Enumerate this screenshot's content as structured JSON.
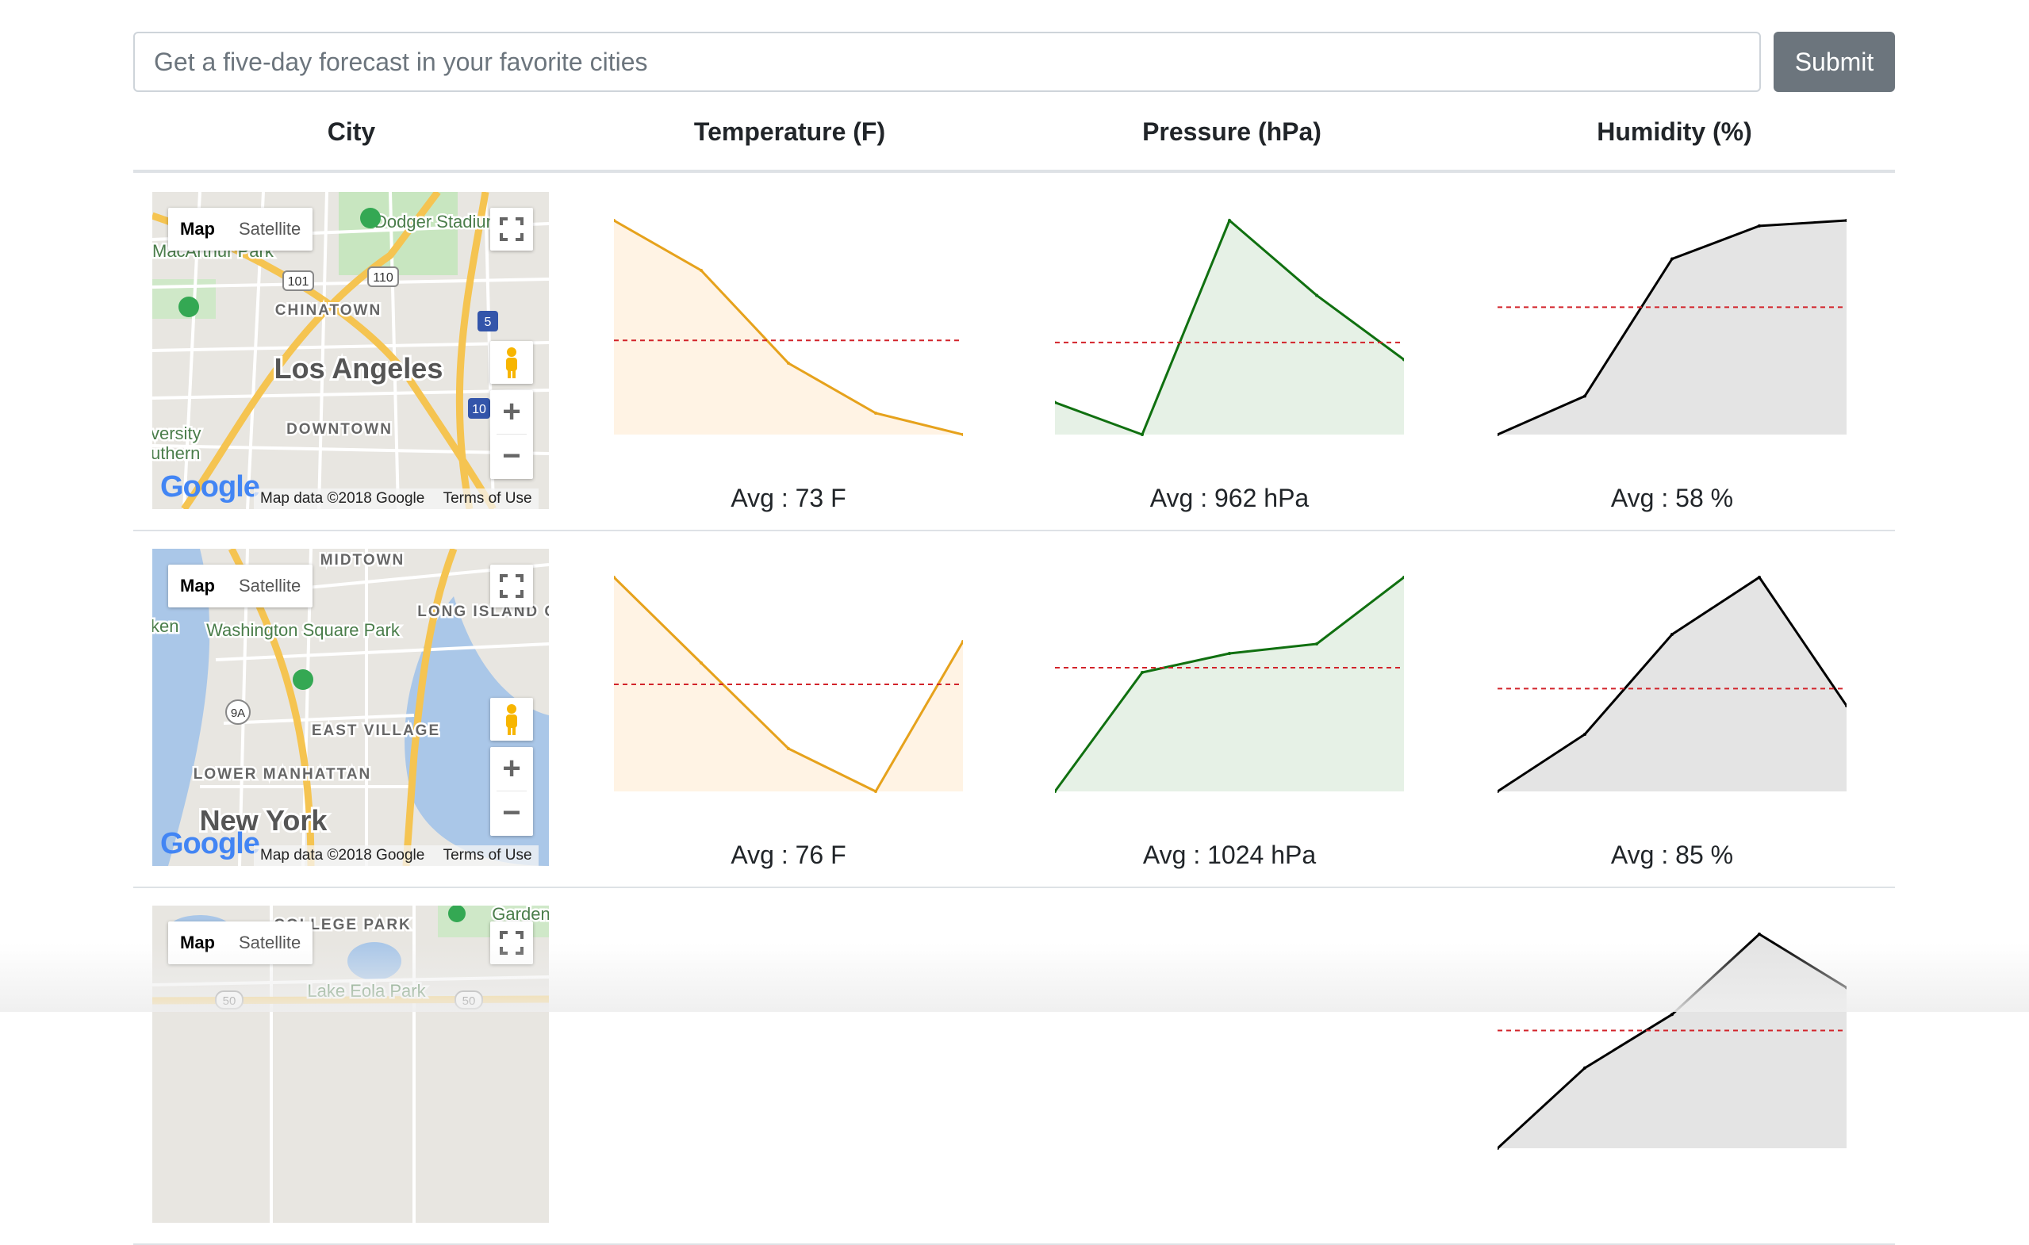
{
  "search": {
    "placeholder": "Get a five-day forecast in your favorite cities",
    "value": "",
    "submit_label": "Submit"
  },
  "table": {
    "headers": [
      "City",
      "Temperature (F)",
      "Pressure (hPa)",
      "Humidity (%)"
    ]
  },
  "map_controls": {
    "map_label": "Map",
    "satellite_label": "Satellite",
    "zoom_in": "+",
    "zoom_out": "−",
    "map_data": "Map data ©2018 Google",
    "terms": "Terms of Use",
    "logo": "Google"
  },
  "colors": {
    "temperature": "#e6a21c",
    "temperature_fill": "#fff3e4",
    "pressure": "#107010",
    "pressure_fill": "#e6f1e6",
    "humidity": "#000000",
    "humidity_fill": "#e4e4e4",
    "average": "#d2232a"
  },
  "rows": [
    {
      "map_labels": {
        "city": "Los Angeles",
        "poi_1": "Dodger Stadium",
        "poi_2": "MacArthur Park",
        "district_1": "CHINATOWN",
        "district_2": "DOWNTOWN",
        "partial": "versity",
        "partial_2": "uthern",
        "route_1": "101",
        "route_2": "110",
        "route_3": "5",
        "route_4": "10"
      },
      "temperature": {
        "values": [
          78,
          74.5,
          68,
          64.5,
          63
        ],
        "avg_label": "Avg : 73 F"
      },
      "pressure": {
        "values": [
          958,
          955,
          975,
          968,
          962
        ],
        "avg_label": "Avg : 962 hPa"
      },
      "humidity": {
        "values": [
          43,
          50,
          75,
          81,
          82
        ],
        "avg_label": "Avg : 58 %"
      }
    },
    {
      "map_labels": {
        "city": "New York",
        "poi_1": "Washington Square Park",
        "district_1": "MIDTOWN",
        "district_2": "EAST VILLAGE",
        "district_3": "LOWER MANHATTAN",
        "district_4": "LONG ISLAND CITY",
        "partial": "ken",
        "route_1": "9A"
      },
      "temperature": {
        "values": [
          78.5,
          76.5,
          74.5,
          73.5,
          77
        ],
        "avg_label": "Avg : 76 F"
      },
      "pressure": {
        "values": [
          1000,
          1025,
          1029,
          1031,
          1045
        ],
        "avg_label": "Avg : 1024 hPa"
      },
      "humidity": {
        "values": [
          78,
          82,
          89,
          93,
          84
        ],
        "avg_label": "Avg : 85 %"
      }
    },
    {
      "map_labels": {
        "poi_1": "Lake Eola Park",
        "poi_2": "Garden",
        "district_1": "COLLEGE PARK",
        "route_1": "50"
      },
      "humidity": {
        "values": [
          60,
          66,
          70,
          76,
          72
        ]
      }
    }
  ]
}
